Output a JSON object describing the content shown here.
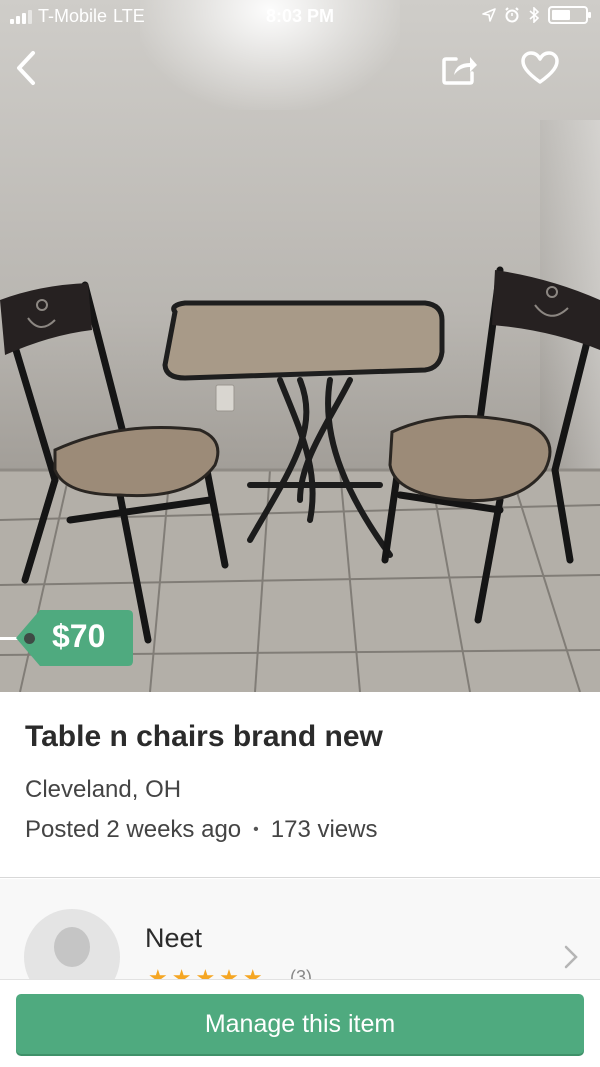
{
  "status_bar": {
    "carrier": "T-Mobile",
    "network": "LTE",
    "time": "8:03 PM",
    "battery_level": 0.55
  },
  "nav": {
    "back_icon": "chevron-left-icon",
    "share_icon": "share-icon",
    "favorite_icon": "heart-icon"
  },
  "listing": {
    "price": "$70",
    "title": "Table n chairs brand new",
    "location": "Cleveland, OH",
    "posted": "Posted 2 weeks ago",
    "separator": "•",
    "views": "173 views"
  },
  "seller": {
    "name": "Neet",
    "rating": 5,
    "rating_count": "(3)"
  },
  "actions": {
    "manage_label": "Manage this item"
  },
  "colors": {
    "brand_green": "#4faa7f",
    "star": "#f5a623"
  }
}
